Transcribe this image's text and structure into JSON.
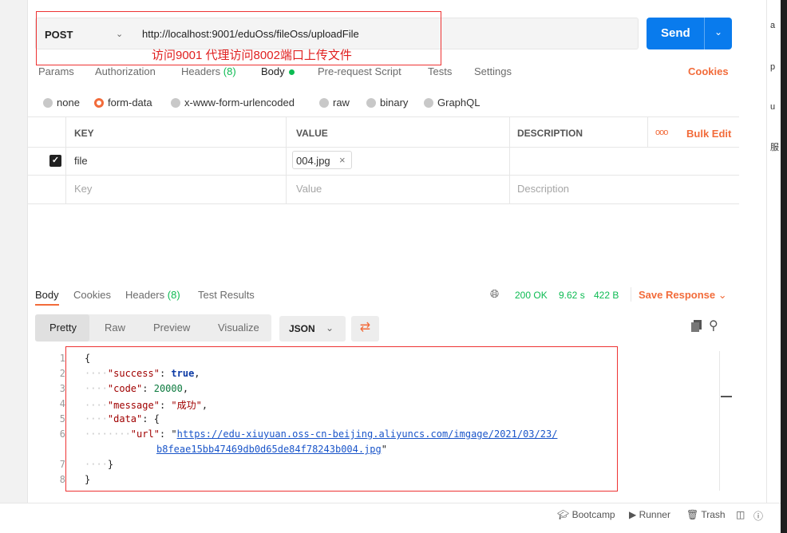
{
  "request": {
    "method": "POST",
    "url": "http://localhost:9001/eduOss/fileOss/uploadFile",
    "annotation": "访问9001 代理访问8002端口上传文件",
    "send_label": "Send"
  },
  "tabs": [
    {
      "label": "Params"
    },
    {
      "label": "Authorization"
    },
    {
      "label": "Headers",
      "count": "(8)"
    },
    {
      "label": "Body"
    },
    {
      "label": "Pre-request Script"
    },
    {
      "label": "Tests"
    },
    {
      "label": "Settings"
    }
  ],
  "cookies_label": "Cookies",
  "body_types": [
    "none",
    "form-data",
    "x-www-form-urlencoded",
    "raw",
    "binary",
    "GraphQL"
  ],
  "body_type_selected": "form-data",
  "params_table": {
    "headers": [
      "KEY",
      "VALUE",
      "DESCRIPTION"
    ],
    "bulk_edit": "Bulk Edit",
    "more": "ooo",
    "rows": [
      {
        "checked": true,
        "key": "file",
        "value": "004.jpg",
        "description": ""
      }
    ],
    "placeholder": {
      "key": "Key",
      "value": "Value",
      "description": "Description"
    }
  },
  "response": {
    "tabs": [
      {
        "label": "Body"
      },
      {
        "label": "Cookies"
      },
      {
        "label": "Headers",
        "count": "(8)"
      },
      {
        "label": "Test Results"
      }
    ],
    "status": "200 OK",
    "time": "9.62 s",
    "size": "422 B",
    "save_label": "Save Response",
    "views": [
      "Pretty",
      "Raw",
      "Preview",
      "Visualize"
    ],
    "format": "JSON",
    "line_numbers": [
      "1",
      "2",
      "3",
      "4",
      "5",
      "6",
      "",
      "7",
      "8"
    ],
    "json": {
      "success_key": "\"success\"",
      "success_val": "true",
      "code_key": "\"code\"",
      "code_val": "20000",
      "message_key": "\"message\"",
      "message_val": "\"成功\"",
      "data_key": "\"data\"",
      "url_key": "\"url\"",
      "url_part1": "https://edu-xiuyuan.oss-cn-beijing.aliyuncs.com/imgage/2021/03/23/",
      "url_part2": "b8feae15bb47469db0d65de84f78243b004.jpg"
    }
  },
  "right_pane_glyphs": [
    "a",
    "p",
    "u",
    "服"
  ],
  "footer": [
    "Bootcamp",
    "Runner",
    "Trash"
  ]
}
